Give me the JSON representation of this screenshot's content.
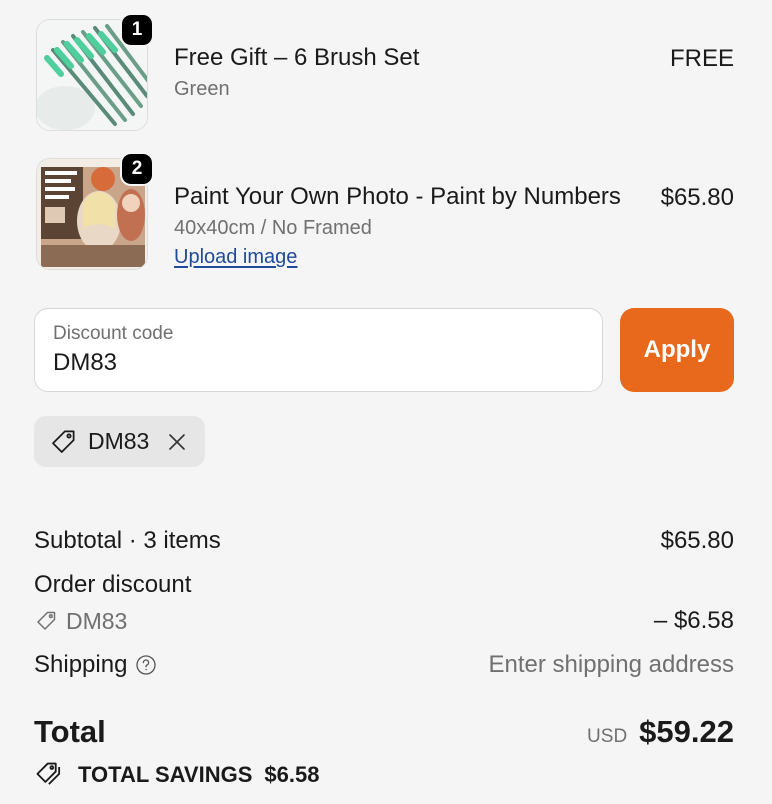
{
  "line_items": [
    {
      "quantity": "1",
      "title": "Free Gift – 6 Brush Set",
      "variant": "Green",
      "price": "FREE",
      "image_icon": "paint-brushes"
    },
    {
      "quantity": "2",
      "title": "Paint Your Own Photo - Paint by Numbers",
      "variant": "40x40cm / No Framed",
      "link": "Upload image",
      "price": "$65.80",
      "image_icon": "photo-collage"
    }
  ],
  "discount": {
    "label": "Discount code",
    "value": "DM83",
    "apply_label": "Apply",
    "applied_code": "DM83",
    "accent_color": "#e8691c"
  },
  "summary": {
    "subtotal_label": "Subtotal · 3 items",
    "subtotal_value": "$65.80",
    "order_discount_label": "Order discount",
    "order_discount_code": "DM83",
    "order_discount_value": "– $6.58",
    "shipping_label": "Shipping",
    "shipping_value": "Enter shipping address",
    "total_label": "Total",
    "currency": "USD",
    "total_value": "$59.22",
    "savings_label": "TOTAL SAVINGS",
    "savings_value": "$6.58"
  }
}
